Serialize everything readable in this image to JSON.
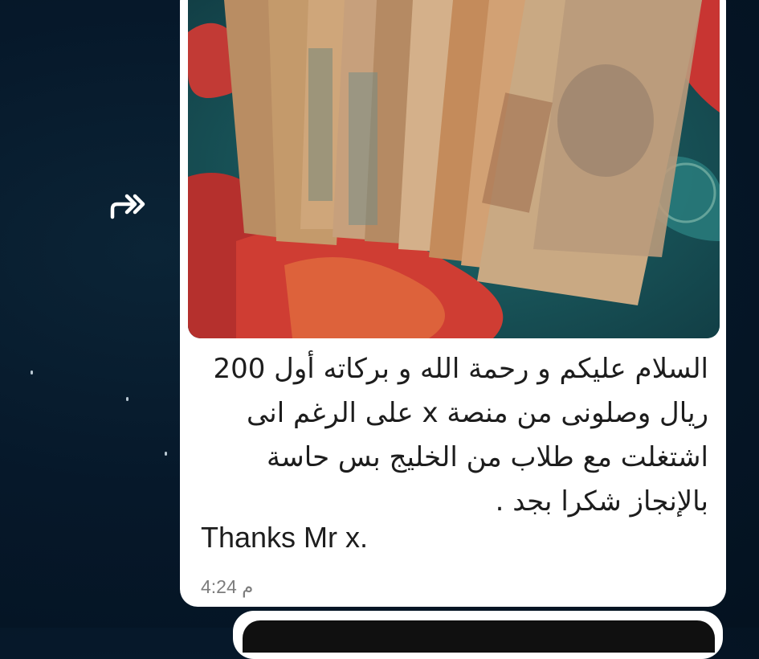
{
  "message": {
    "image_icon": "egyptian-banknotes-photo",
    "text_ar": "السلام عليكم و رحمة الله و بركاته أول 200 ريال وصلونى من منصة x على الرغم انى اشتغلت مع طلاب من الخليج بس حاسة بالإنجاز شكرا بجد .",
    "text_en": "Thanks Mr x.",
    "time": "4:24 م"
  },
  "forward_button": {
    "icon": "forward-double-arrow-icon"
  },
  "colors": {
    "background": "#06182a",
    "bubble": "#ffffff",
    "text": "#1d1d1d",
    "time": "#7c7c7c"
  }
}
